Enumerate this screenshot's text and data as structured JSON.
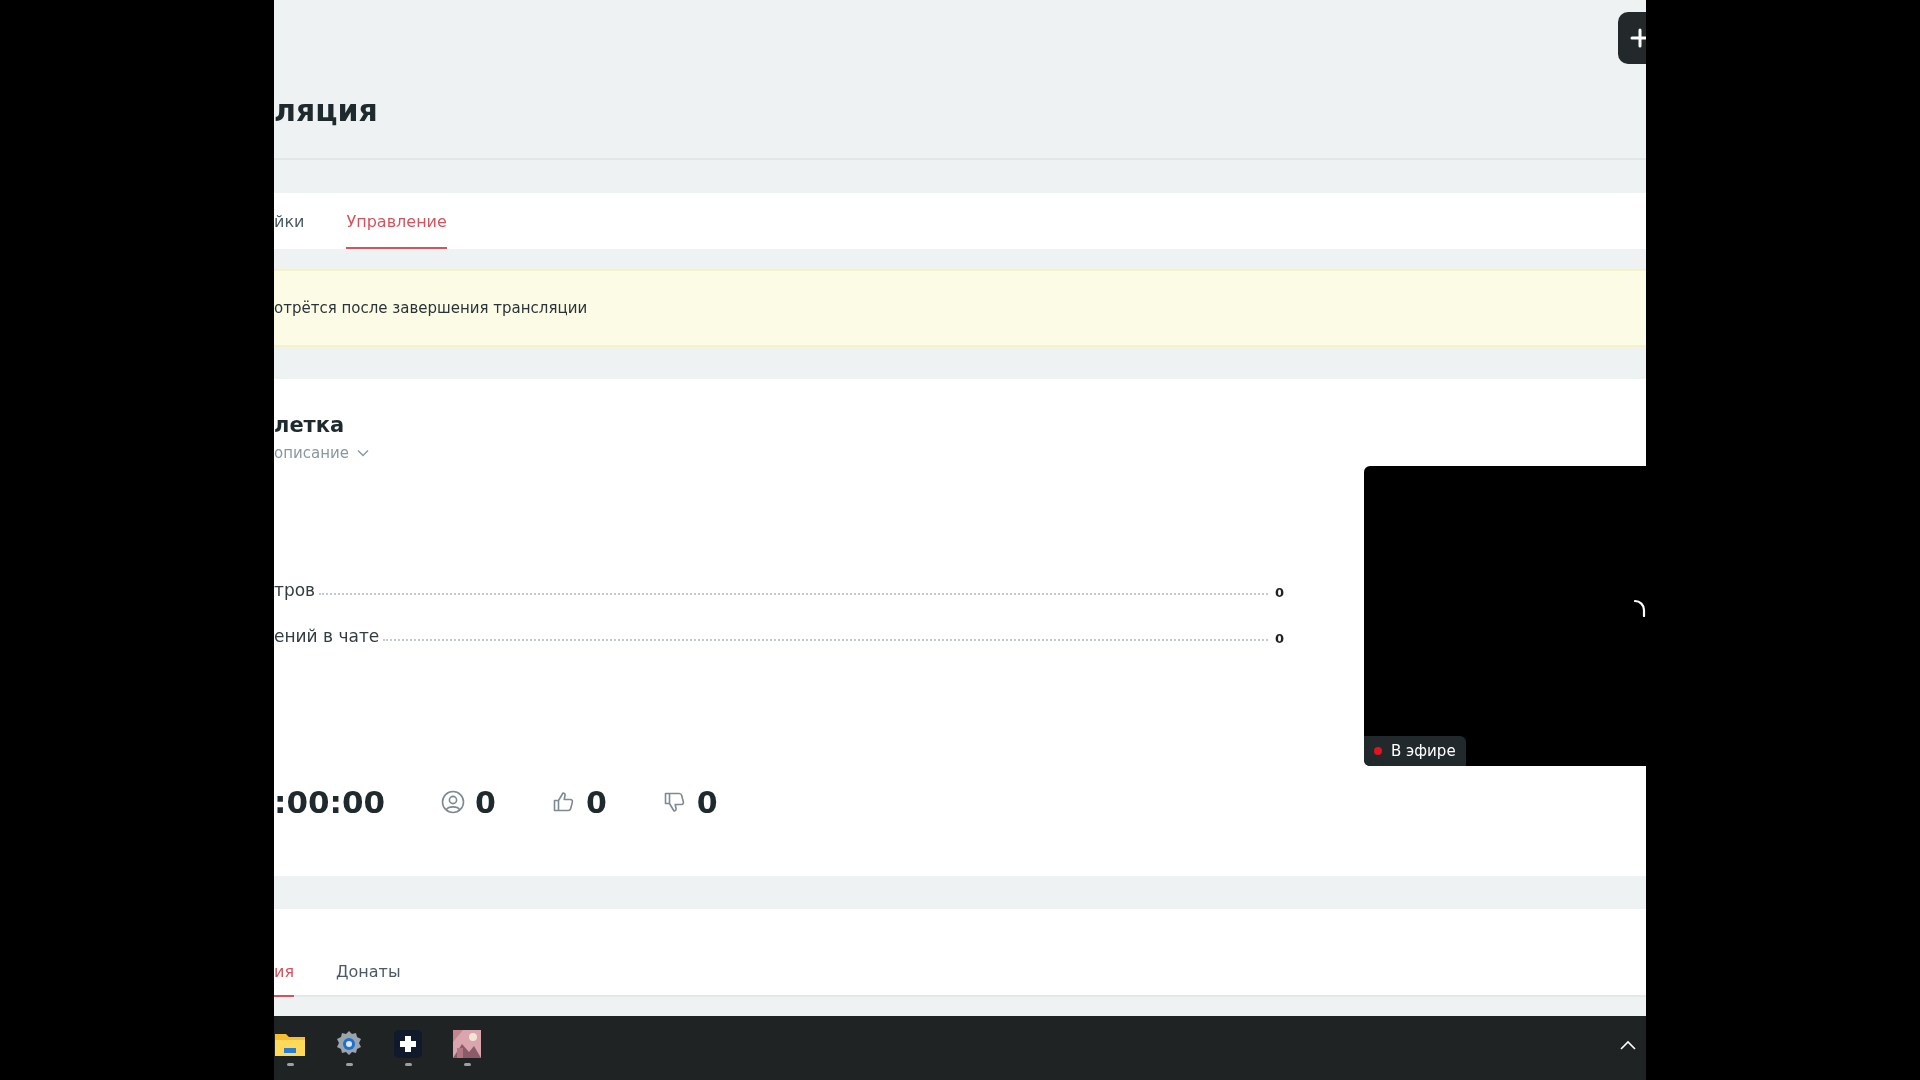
{
  "page_title": "ляция",
  "tabs": [
    {
      "label": "йки",
      "selected": false
    },
    {
      "label": "Управление",
      "selected": true
    }
  ],
  "notice": "отрётся после завершения трансляции",
  "stream": {
    "title": "летка",
    "description_toggle": "описание",
    "stats": [
      {
        "label": "тров",
        "value": "0"
      },
      {
        "label": "ений в чате",
        "value": "0"
      }
    ],
    "duration": ":00:00",
    "counters": [
      {
        "kind": "viewers",
        "value": "0"
      },
      {
        "kind": "likes",
        "value": "0"
      },
      {
        "kind": "dislikes",
        "value": "0"
      }
    ],
    "preview": {
      "live_label": "В эфире",
      "loading": true
    }
  },
  "bottom_tabs": [
    {
      "label": "ия",
      "selected": true
    },
    {
      "label": "Донаты",
      "selected": false
    }
  ],
  "taskbar": {
    "apps": [
      {
        "kind": "folder"
      },
      {
        "kind": "settings"
      },
      {
        "kind": "plus"
      },
      {
        "kind": "picture"
      }
    ]
  }
}
